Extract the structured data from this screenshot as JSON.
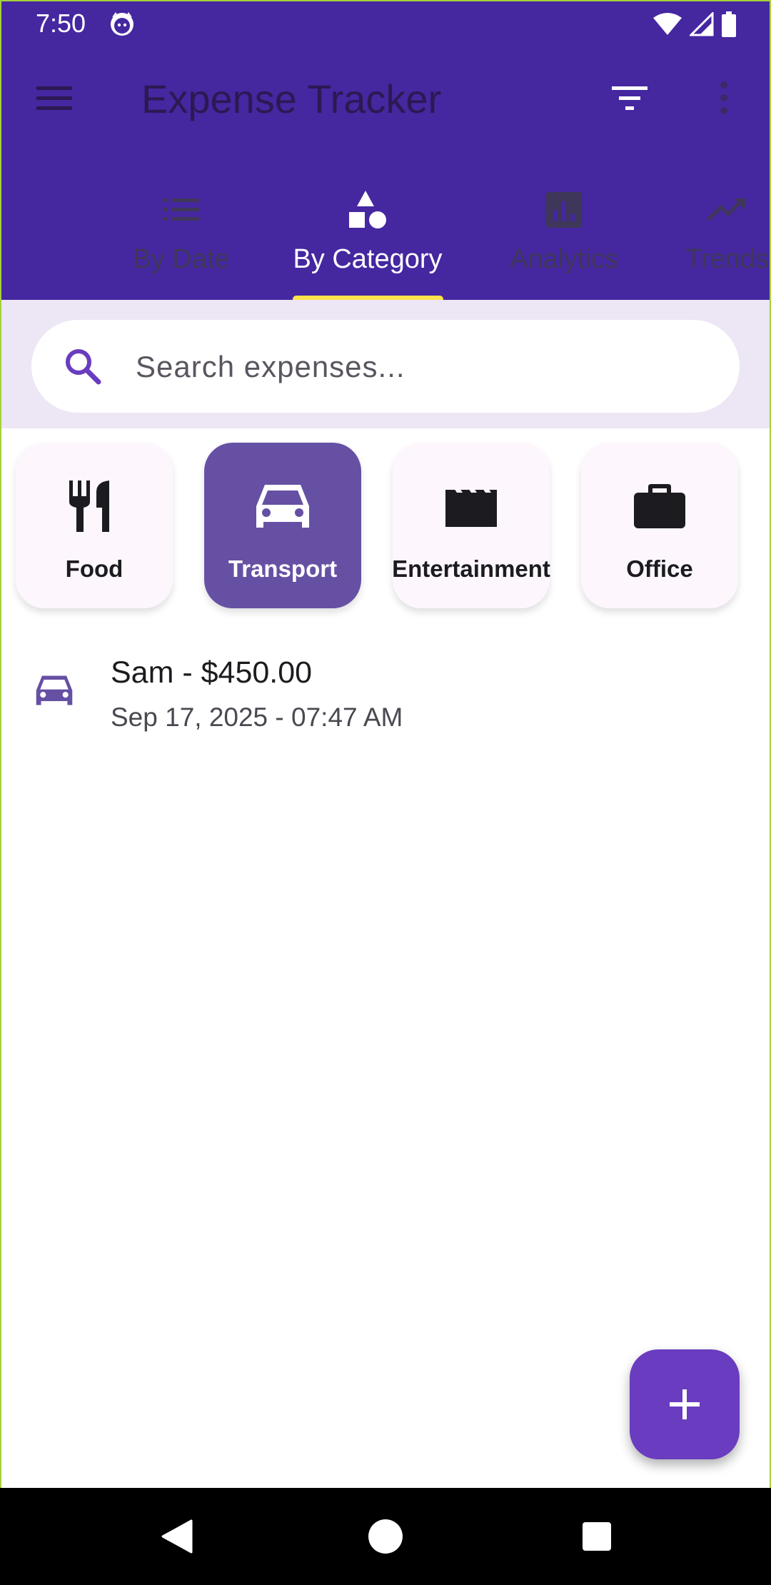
{
  "status_bar": {
    "time": "7:50"
  },
  "app": {
    "title": "Expense Tracker"
  },
  "tabs": [
    {
      "label": "By Date",
      "active": false
    },
    {
      "label": "By Category",
      "active": true
    },
    {
      "label": "Analytics",
      "active": false
    },
    {
      "label": "Trends",
      "active": false
    }
  ],
  "search": {
    "placeholder": "Search expenses...",
    "value": ""
  },
  "categories": [
    {
      "label": "Food",
      "icon": "restaurant-icon",
      "selected": false
    },
    {
      "label": "Transport",
      "icon": "car-icon",
      "selected": true
    },
    {
      "label": "Entertainment",
      "icon": "movie-clapper-icon",
      "selected": false
    },
    {
      "label": "Office",
      "icon": "briefcase-icon",
      "selected": false
    }
  ],
  "expenses": [
    {
      "title": "Sam - $450.00",
      "subtitle": "Sep 17, 2025 - 07:47 AM",
      "icon": "car-icon"
    }
  ],
  "colors": {
    "primary": "#4527a0",
    "accent": "#ffe24a",
    "selected_chip": "#6650a4",
    "fab": "#6a3cbf"
  }
}
